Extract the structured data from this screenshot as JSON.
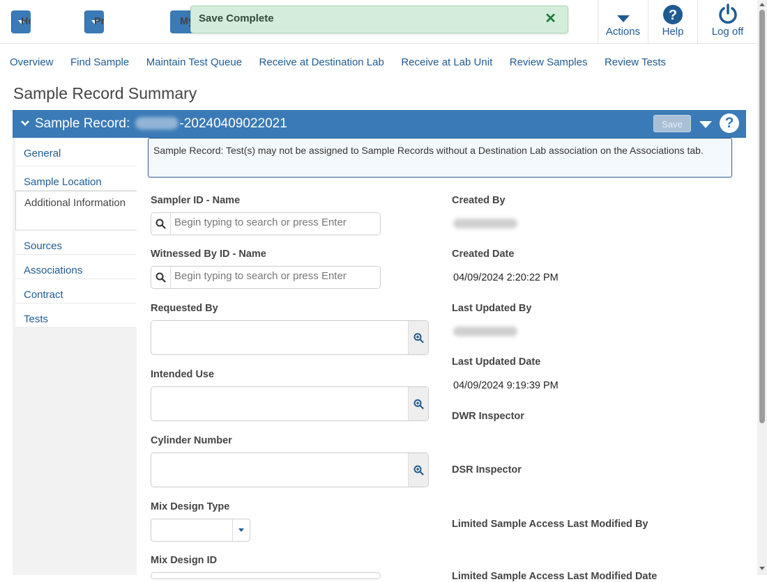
{
  "toolbar": {
    "home_label": "Home",
    "previous_label": "Previous",
    "my_label": "My",
    "actions_label": "Actions",
    "help_label": "Help",
    "logoff_label": "Log off"
  },
  "toast": {
    "message": "Save Complete",
    "close_glyph": "✕",
    "color": "#d4eddb"
  },
  "nav": {
    "links": [
      "Overview",
      "Find Sample",
      "Maintain Test Queue",
      "Receive at Destination Lab",
      "Receive at Lab Unit",
      "Review Samples",
      "Review Tests"
    ]
  },
  "page_title": "Sample Record Summary",
  "record": {
    "prefix": "Sample Record:",
    "id_suffix": "-20240409022021",
    "save_label": "Save",
    "help_glyph": "?",
    "color": "#3a7ab7"
  },
  "sidebar": {
    "items": [
      {
        "label": "General"
      },
      {
        "label": "Sample Location"
      },
      {
        "label": "Additional Information"
      },
      {
        "label": "Sources"
      },
      {
        "label": "Associations"
      },
      {
        "label": "Contract"
      },
      {
        "label": "Tests"
      }
    ],
    "active_index": 2
  },
  "info_message": "Sample Record: Test(s) may not be assigned to Sample Records without a Destination Lab association on the Associations tab.",
  "form": {
    "sampler_label": "Sampler ID - Name",
    "sampler_placeholder": "Begin typing to search or press Enter",
    "witnessed_label": "Witnessed By ID - Name",
    "witnessed_placeholder": "Begin typing to search or press Enter",
    "requested_label": "Requested By",
    "requested_value": "",
    "intended_label": "Intended Use",
    "intended_value": "",
    "cylinder_label": "Cylinder Number",
    "cylinder_value": "",
    "mix_type_label": "Mix Design Type",
    "mix_type_value": "",
    "mix_id_label": "Mix Design ID"
  },
  "details": {
    "created_by_label": "Created By",
    "created_date_label": "Created Date",
    "created_date": "04/09/2024 2:20:22 PM",
    "updated_by_label": "Last Updated By",
    "updated_date_label": "Last Updated Date",
    "updated_date": "04/09/2024 9:19:39 PM",
    "dwr_label": "DWR Inspector",
    "dsr_label": "DSR Inspector",
    "limited_modified_by_label": "Limited Sample Access Last Modified By",
    "limited_modified_date_label": "Limited Sample Access Last Modified Date"
  }
}
